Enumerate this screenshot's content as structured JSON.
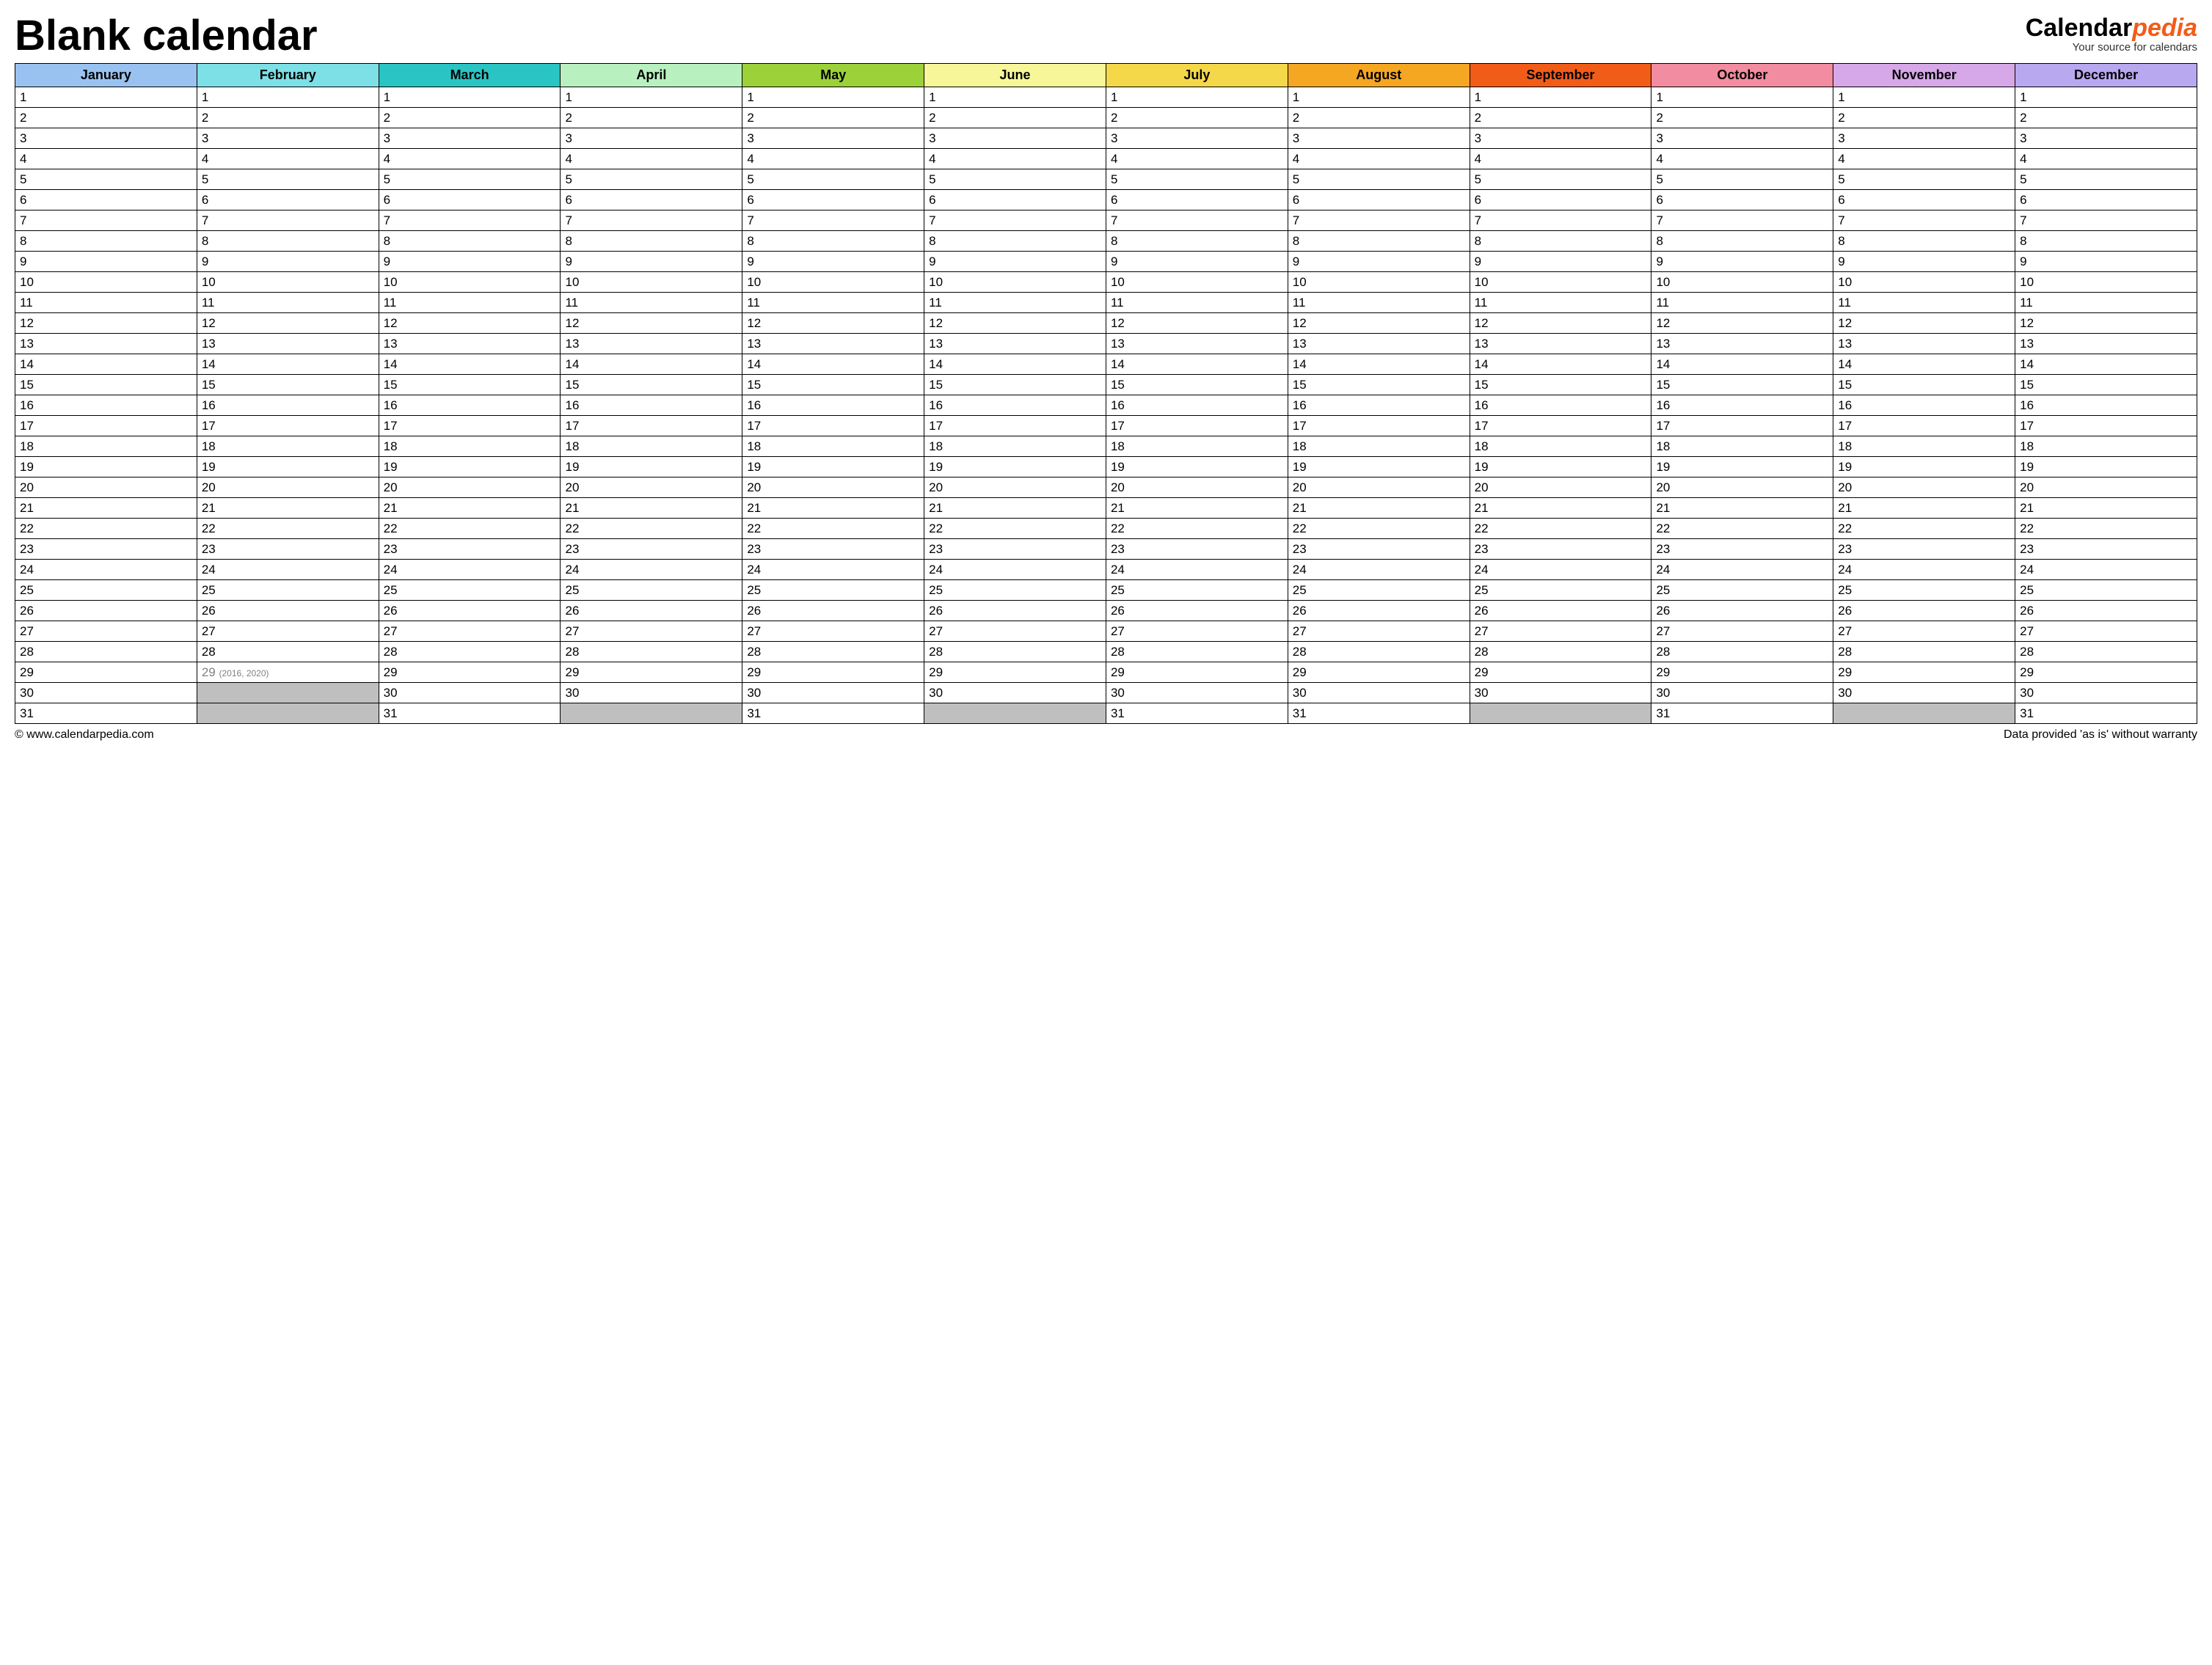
{
  "title": "Blank calendar",
  "brand": {
    "part1": "Calendar",
    "part2": "pedia",
    "sub": "Your source for calendars"
  },
  "months": [
    {
      "name": "January",
      "days": 31
    },
    {
      "name": "February",
      "days": 28,
      "leap": {
        "day": 29,
        "note": "(2016, 2020)"
      }
    },
    {
      "name": "March",
      "days": 31
    },
    {
      "name": "April",
      "days": 30
    },
    {
      "name": "May",
      "days": 31
    },
    {
      "name": "June",
      "days": 30
    },
    {
      "name": "July",
      "days": 31
    },
    {
      "name": "August",
      "days": 31
    },
    {
      "name": "September",
      "days": 30
    },
    {
      "name": "October",
      "days": 31
    },
    {
      "name": "November",
      "days": 30
    },
    {
      "name": "December",
      "days": 31
    }
  ],
  "max_rows": 31,
  "footer": {
    "left": "© www.calendarpedia.com",
    "right": "Data provided 'as is' without warranty"
  }
}
